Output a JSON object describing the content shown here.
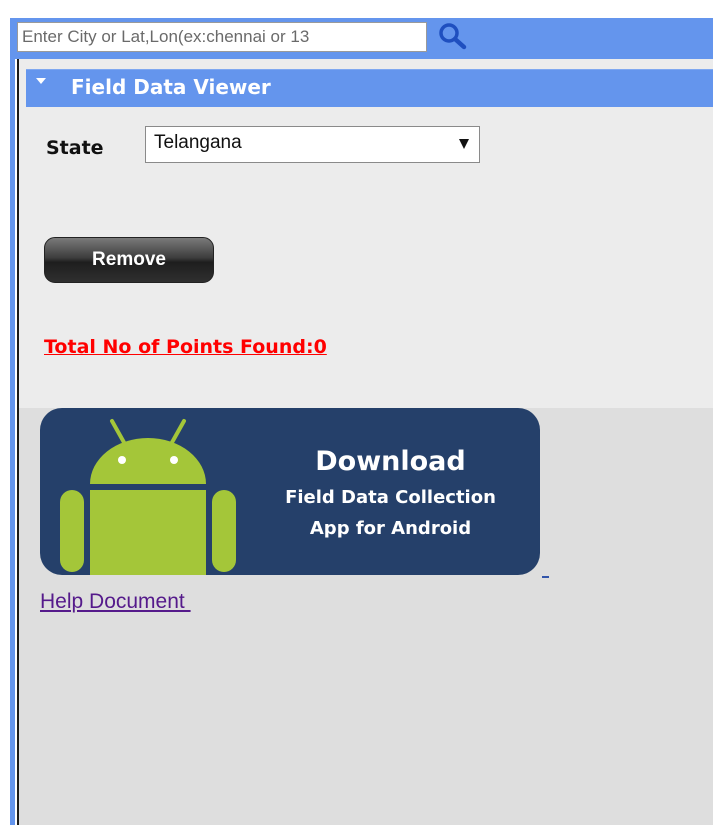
{
  "search": {
    "placeholder": "Enter City or Lat,Lon(ex:chennai or 13"
  },
  "panel": {
    "title": "Field Data Viewer",
    "state_label": "State",
    "state_selected": "Telangana",
    "remove_label": "Remove",
    "points_found": "Total No of Points Found:0",
    "banner": {
      "title": "Download",
      "line1": "Field Data Collection",
      "line2": "App for Android"
    },
    "help_link": "Help Document "
  },
  "colors": {
    "header_blue": "#6495ED",
    "banner_navy": "#25406A",
    "android_green": "#A4C639",
    "alert_red": "#FF0000",
    "link_purple": "#551A8B"
  },
  "icons": [
    "search-icon",
    "collapse-arrow-icon",
    "dropdown-arrow-icon",
    "android-icon"
  ]
}
